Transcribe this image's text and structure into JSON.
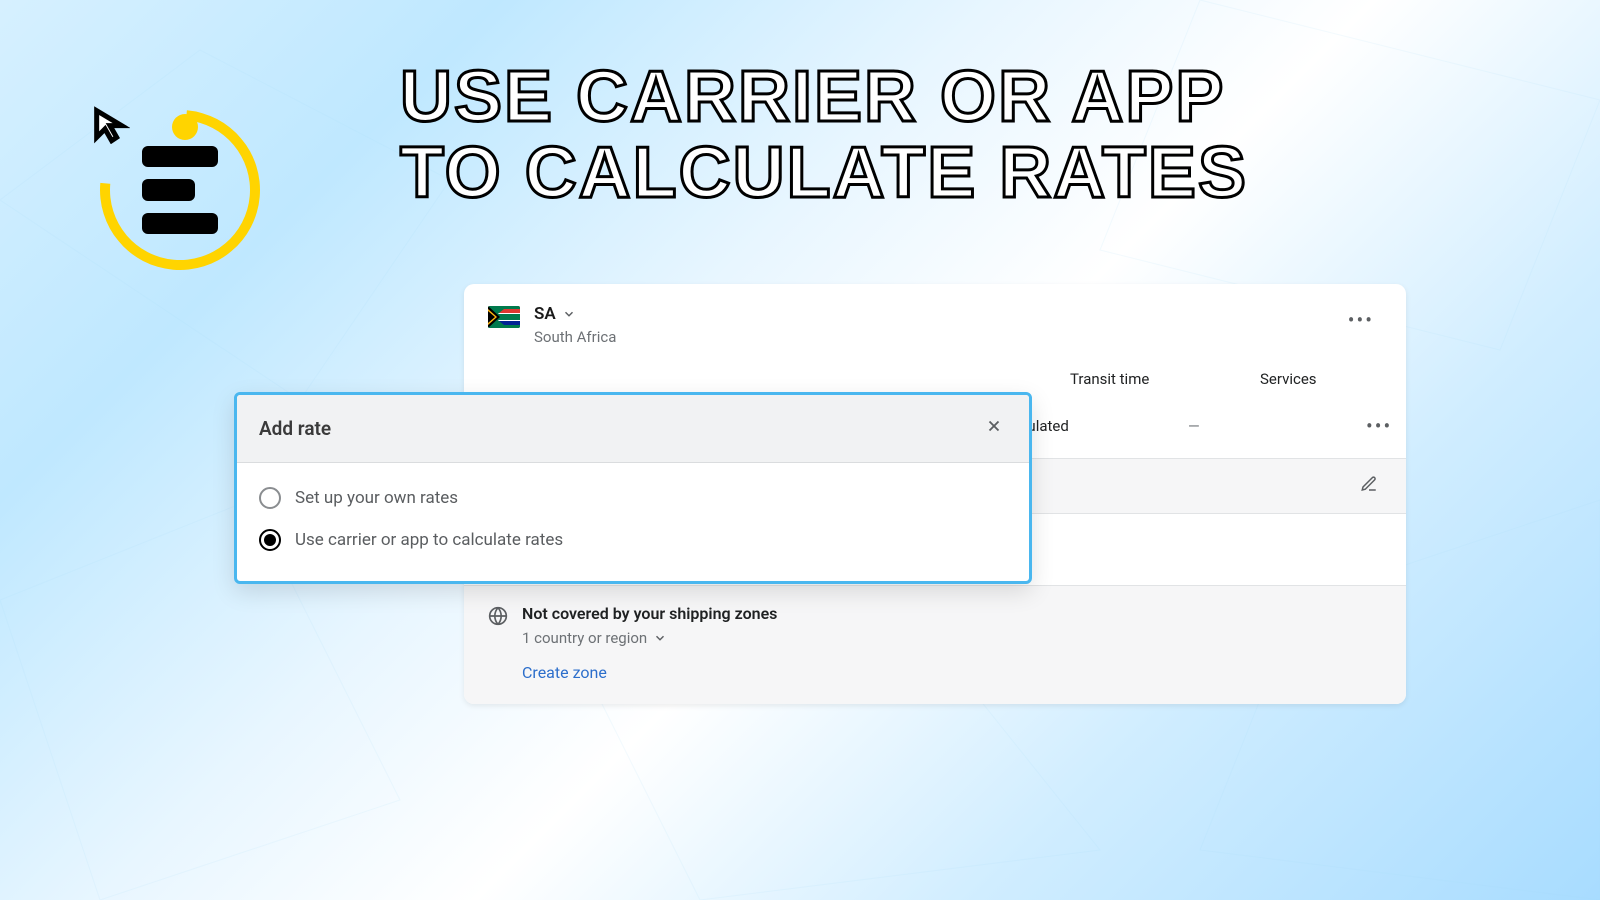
{
  "headline": "USE CARRIER OR APP\nTO CALCULATE RATES",
  "zone": {
    "code": "SA",
    "name": "South Africa"
  },
  "columns": {
    "transit": "Transit time",
    "services": "Services"
  },
  "row": {
    "transit": "Calculated",
    "services": "—"
  },
  "add_rate_button": "Add rate",
  "not_covered": {
    "title": "Not covered by your shipping zones",
    "sub": "1 country or region",
    "create": "Create zone"
  },
  "modal": {
    "title": "Add rate",
    "options": [
      {
        "label": "Set up your own rates",
        "selected": false
      },
      {
        "label": "Use carrier or app to calculate rates",
        "selected": true
      }
    ]
  }
}
